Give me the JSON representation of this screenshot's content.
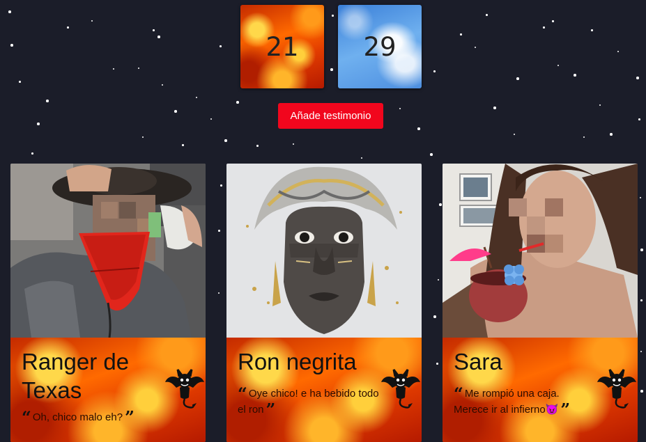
{
  "counters": {
    "hell": {
      "value": "21",
      "theme": "fire"
    },
    "heaven": {
      "value": "29",
      "theme": "sky"
    }
  },
  "actions": {
    "add_testimonial_label": "Añade testimonio"
  },
  "cards": [
    {
      "name": "Ranger de Texas",
      "quote": "Oh, chico malo eh?",
      "image": "man-cowboy-hat-photo",
      "badge_icon": "devil-icon"
    },
    {
      "name": "Ron negrita",
      "quote": "Oye chico! e ha bebido todo el ron",
      "image": "woman-portrait-painting",
      "badge_icon": "devil-icon"
    },
    {
      "name": "Sara",
      "quote": "Me rompió una caja. Merece ir al infierno😈",
      "image": "woman-cocktail-photo",
      "badge_icon": "devil-icon"
    }
  ],
  "colors": {
    "background": "#1b1d29",
    "button": "#f1061d",
    "fire": "#ff6a00",
    "sky": "#6fb0ef"
  }
}
